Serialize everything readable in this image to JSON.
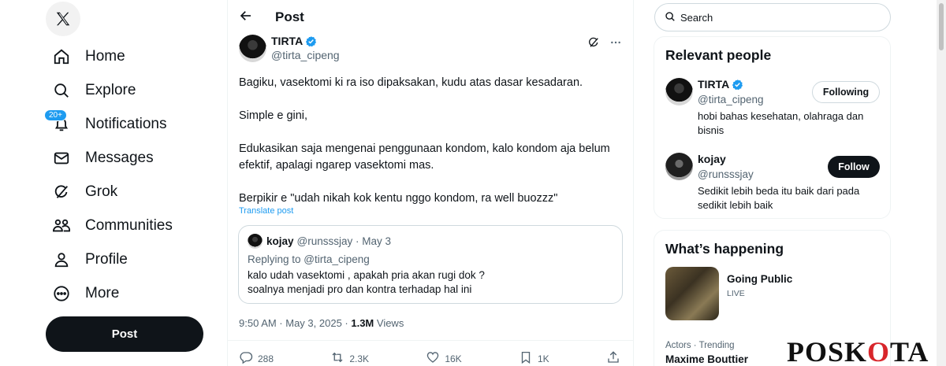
{
  "nav": {
    "items": [
      {
        "label": "Home",
        "icon": "home-icon"
      },
      {
        "label": "Explore",
        "icon": "search-icon"
      },
      {
        "label": "Notifications",
        "icon": "bell-icon",
        "badge": "20+"
      },
      {
        "label": "Messages",
        "icon": "mail-icon"
      },
      {
        "label": "Grok",
        "icon": "grok-icon"
      },
      {
        "label": "Communities",
        "icon": "people-icon"
      },
      {
        "label": "Profile",
        "icon": "user-icon"
      },
      {
        "label": "More",
        "icon": "more-circle-icon"
      }
    ],
    "post_button": "Post"
  },
  "header": {
    "title": "Post"
  },
  "post": {
    "author_name": "TIRTA",
    "author_handle": "@tirta_cipeng",
    "paragraphs": [
      "Bagiku, vasektomi ki ra iso dipaksakan, kudu atas dasar kesadaran.",
      "Simple e gini,",
      "Edukasikan saja mengenai penggunaan kondom, kalo kondom aja belum efektif, apalagi ngarep vasektomi mas.",
      "Berpikir e \"udah nikah kok kentu nggo kondom, ra well buozzz\""
    ],
    "translate": "Translate post",
    "time": "9:50 AM · May 3, 2025 · ",
    "views_count": "1.3M",
    "views_label": " Views",
    "counts": {
      "replies": "288",
      "reposts": "2.3K",
      "likes": "16K",
      "bookmarks": "1K"
    }
  },
  "quote": {
    "name": "kojay",
    "meta": "@runsssjay · May 3",
    "replying": "Replying to @tirta_cipeng",
    "line1": "kalo udah vasektomi , apakah pria akan rugi dok ?",
    "line2": "soalnya menjadi pro dan kontra terhadap hal ini"
  },
  "search": {
    "placeholder": "Search"
  },
  "relevant": {
    "title": "Relevant people",
    "people": [
      {
        "name": "TIRTA",
        "handle": "@tirta_cipeng",
        "bio": "hobi bahas kesehatan, olahraga dan bisnis",
        "button": "Following"
      },
      {
        "name": "kojay",
        "handle": "@runsssjay",
        "bio": "Sedikit lebih beda itu baik dari pada sedikit lebih baik",
        "button": "Follow"
      }
    ]
  },
  "happening": {
    "title": "What’s happening",
    "item1": {
      "title": "Going Public",
      "status": "LIVE"
    },
    "item2": {
      "category": "Actors · Trending",
      "name": "Maxime Bouttier"
    }
  },
  "watermark": {
    "part1": "POSK",
    "part2": "O",
    "part3": "TA"
  },
  "colors": {
    "accent": "#1d9bf0",
    "text": "#0f1419",
    "muted": "#536471",
    "watermark_red": "#d8262b"
  }
}
